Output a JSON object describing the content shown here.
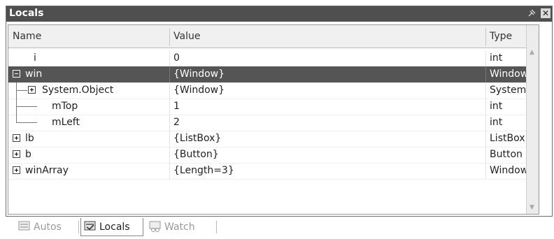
{
  "window": {
    "title": "Locals",
    "close_glyph": "✕"
  },
  "columns": {
    "name": "Name",
    "value": "Value",
    "type": "Type"
  },
  "rows": [
    {
      "name": "i",
      "value": "0",
      "type": "int"
    },
    {
      "name": "win",
      "value": "{Window}",
      "type": "Window",
      "expander": "minus",
      "selected": true
    },
    {
      "name": "System.Object",
      "value": "{Window}",
      "type": "System.C",
      "expander": "plus"
    },
    {
      "name": "mTop",
      "value": "1",
      "type": "int"
    },
    {
      "name": "mLeft",
      "value": "2",
      "type": "int"
    },
    {
      "name": "lb",
      "value": "{ListBox}",
      "type": "ListBox",
      "expander": "plus"
    },
    {
      "name": "b",
      "value": "{Button}",
      "type": "Button",
      "expander": "plus"
    },
    {
      "name": "winArray",
      "value": "{Length=3}",
      "type": "Window[]",
      "expander": "plus"
    }
  ],
  "tabs": [
    {
      "label": "Autos",
      "icon": "autos-icon",
      "active": false
    },
    {
      "label": "Locals",
      "icon": "locals-icon",
      "active": true
    },
    {
      "label": "Watch",
      "icon": "watch-icon",
      "active": false
    }
  ],
  "colors": {
    "titlebar": "#4f4f4f",
    "selected_row": "#555555"
  }
}
